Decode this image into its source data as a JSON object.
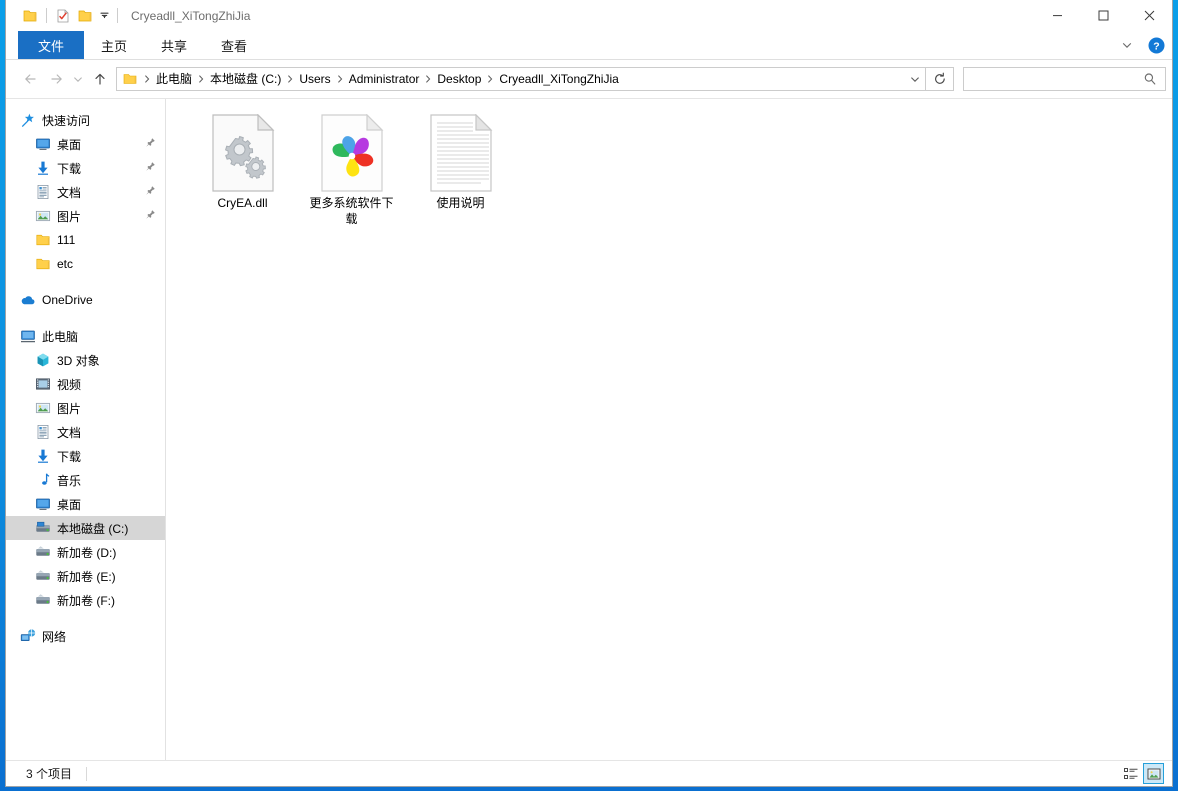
{
  "window": {
    "title": "Cryeadll_XiTongZhiJia",
    "quick_access": [
      {
        "name": "folder-icon",
        "label": "folder"
      },
      {
        "name": "properties-icon",
        "label": "properties"
      },
      {
        "name": "new-folder-icon",
        "label": "new folder"
      },
      {
        "name": "customize-qat-dropdown-icon",
        "label": "customize"
      }
    ],
    "controls": {
      "minimize": "─",
      "maximize": "☐",
      "close": "✕"
    }
  },
  "ribbon": {
    "tabs": [
      {
        "label": "文件",
        "key": "file",
        "active": true
      },
      {
        "label": "主页",
        "key": "home",
        "active": false
      },
      {
        "label": "共享",
        "key": "share",
        "active": false
      },
      {
        "label": "查看",
        "key": "view",
        "active": false
      }
    ],
    "expand_label": "∨",
    "help_label": "?"
  },
  "address": {
    "back_label": "←",
    "forward_label": "→",
    "recent_label": "∨",
    "up_label": "↑",
    "breadcrumbs": [
      "此电脑",
      "本地磁盘 (C:)",
      "Users",
      "Administrator",
      "Desktop",
      "Cryeadll_XiTongZhiJia"
    ],
    "separator": "›",
    "dropdown_label": "∨",
    "refresh_label": "↻"
  },
  "search": {
    "value": "",
    "placeholder": ""
  },
  "sidebar": {
    "groups": [
      {
        "header": {
          "label": "快速访问",
          "icon": "star-pin-icon",
          "level": 0
        },
        "items": [
          {
            "label": "桌面",
            "icon": "desktop-icon",
            "level": 1,
            "pinned": true
          },
          {
            "label": "下载",
            "icon": "downloads-icon",
            "level": 1,
            "pinned": true
          },
          {
            "label": "文档",
            "icon": "documents-icon",
            "level": 1,
            "pinned": true
          },
          {
            "label": "图片",
            "icon": "pictures-icon",
            "level": 1,
            "pinned": true
          },
          {
            "label": "111",
            "icon": "folder-icon",
            "level": 1,
            "pinned": false
          },
          {
            "label": "etc",
            "icon": "folder-icon",
            "level": 1,
            "pinned": false
          }
        ]
      },
      {
        "header": {
          "label": "OneDrive",
          "icon": "onedrive-icon",
          "level": 0
        },
        "items": []
      },
      {
        "header": {
          "label": "此电脑",
          "icon": "this-pc-icon",
          "level": 0
        },
        "items": [
          {
            "label": "3D 对象",
            "icon": "3d-objects-icon",
            "level": 1,
            "pinned": false
          },
          {
            "label": "视频",
            "icon": "videos-icon",
            "level": 1,
            "pinned": false
          },
          {
            "label": "图片",
            "icon": "pictures-icon",
            "level": 1,
            "pinned": false
          },
          {
            "label": "文档",
            "icon": "documents-icon",
            "level": 1,
            "pinned": false
          },
          {
            "label": "下载",
            "icon": "downloads-icon",
            "level": 1,
            "pinned": false
          },
          {
            "label": "音乐",
            "icon": "music-icon",
            "level": 1,
            "pinned": false
          },
          {
            "label": "桌面",
            "icon": "desktop-icon",
            "level": 1,
            "pinned": false
          },
          {
            "label": "本地磁盘 (C:)",
            "icon": "system-drive-icon",
            "level": 1,
            "pinned": false,
            "selected": true
          },
          {
            "label": "新加卷 (D:)",
            "icon": "drive-icon",
            "level": 1,
            "pinned": false
          },
          {
            "label": "新加卷 (E:)",
            "icon": "drive-icon",
            "level": 1,
            "pinned": false
          },
          {
            "label": "新加卷 (F:)",
            "icon": "drive-icon",
            "level": 1,
            "pinned": false
          }
        ]
      },
      {
        "header": {
          "label": "网络",
          "icon": "network-icon",
          "level": 0
        },
        "items": []
      }
    ]
  },
  "files": [
    {
      "name": "CryEA.dll",
      "icon": "dll-gears-icon"
    },
    {
      "name": "更多系统软件下载",
      "icon": "pinwheel-shortcut-icon"
    },
    {
      "name": "使用说明",
      "icon": "text-document-icon"
    }
  ],
  "status": {
    "item_count": "3 个项目",
    "views": [
      {
        "name": "details-view",
        "active": false
      },
      {
        "name": "large-icons-view",
        "active": true
      }
    ]
  },
  "colors": {
    "accent": "#1a6fc4",
    "selection": "#d6d6d6",
    "hover": "#e5f3fb",
    "desktop": "#0d8fdf",
    "folder": "#ffd04b"
  }
}
